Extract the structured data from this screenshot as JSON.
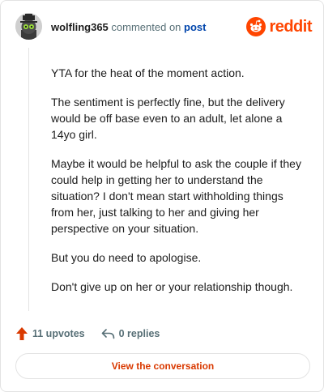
{
  "header": {
    "username": "wolfling365",
    "action_text": "commented on",
    "post_link": "post",
    "brand_name": "reddit"
  },
  "comment": {
    "paragraphs": [
      "YTA for the heat of the moment action.",
      "The sentiment is perfectly fine, but the delivery would be off base even to an adult, let alone a 14yo girl.",
      "Maybe it would be helpful to ask the couple if they could help in getting her to understand the situation? I don't mean start withholding things from her, just talking to her and giving her perspective on your situation.",
      "But you do need to apologise.",
      "Don't give up on her or your relationship though."
    ]
  },
  "actions": {
    "upvotes": "11 upvotes",
    "replies": "0 replies",
    "upvote_icon": "upvote-arrow-icon",
    "reply_icon": "reply-arrow-icon"
  },
  "cta": {
    "label": "View the conversation"
  },
  "colors": {
    "brand": "#ff4500",
    "link": "#0045ac",
    "cta_text": "#d93900",
    "muted": "#576f76",
    "border": "#e3e3e3"
  }
}
